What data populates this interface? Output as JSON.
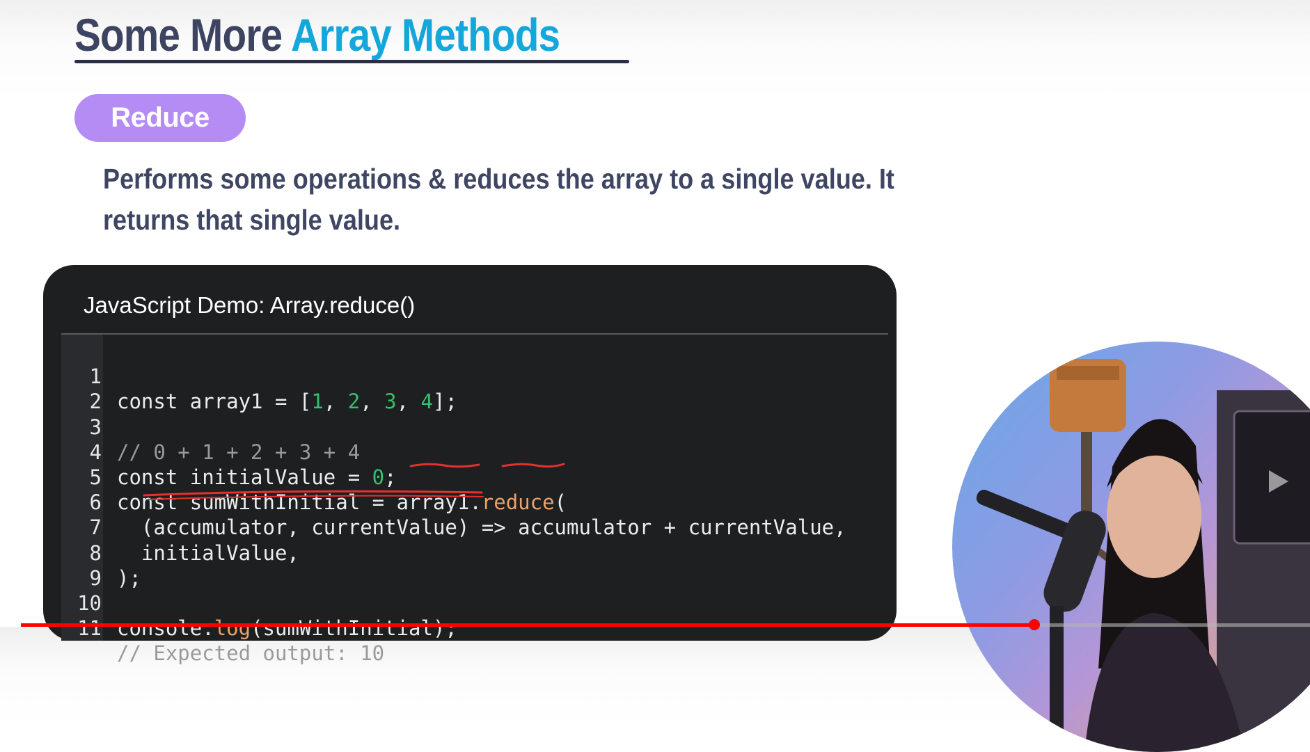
{
  "slide": {
    "title_part1": "Some More ",
    "title_part2": "Array Methods",
    "pill_label": "Reduce",
    "description": "Performs some operations & reduces the array to a single value. It returns that single value.",
    "colors": {
      "title_text": "#3d4461",
      "title_accent": "#14a7db",
      "pill": "#b48cf4",
      "description_text": "#3f4663",
      "annotation_ink": "#e53030"
    }
  },
  "demo": {
    "title": "JavaScript Demo: Array.reduce()",
    "background": "#1e1f21",
    "line_numbers": [
      "1",
      "2",
      "3",
      "4",
      "5",
      "6",
      "7",
      "8",
      "9",
      "10",
      "11"
    ],
    "code": {
      "l1_a": "const array1 = [",
      "l1_n1": "1",
      "l1_c1": ", ",
      "l1_n2": "2",
      "l1_c2": ", ",
      "l1_n3": "3",
      "l1_c3": ", ",
      "l1_n4": "4",
      "l1_b": "];",
      "l3": "// 0 + 1 + 2 + 3 + 4",
      "l4_a": "const initialValue = ",
      "l4_n": "0",
      "l4_b": ";",
      "l5_a": "const sumWithInitial = array1.",
      "l5_fn": "reduce",
      "l5_b": "(",
      "l6": "  (accumulator, currentValue) => accumulator + currentValue,",
      "l7": "  initialValue,",
      "l8": ");",
      "l10_a": "console.",
      "l10_fn": "log",
      "l10_b": "(sumWithInitial);",
      "l11": "// Expected output: 10"
    }
  },
  "player": {
    "progress": 0.786,
    "accent": "#ff0000"
  }
}
